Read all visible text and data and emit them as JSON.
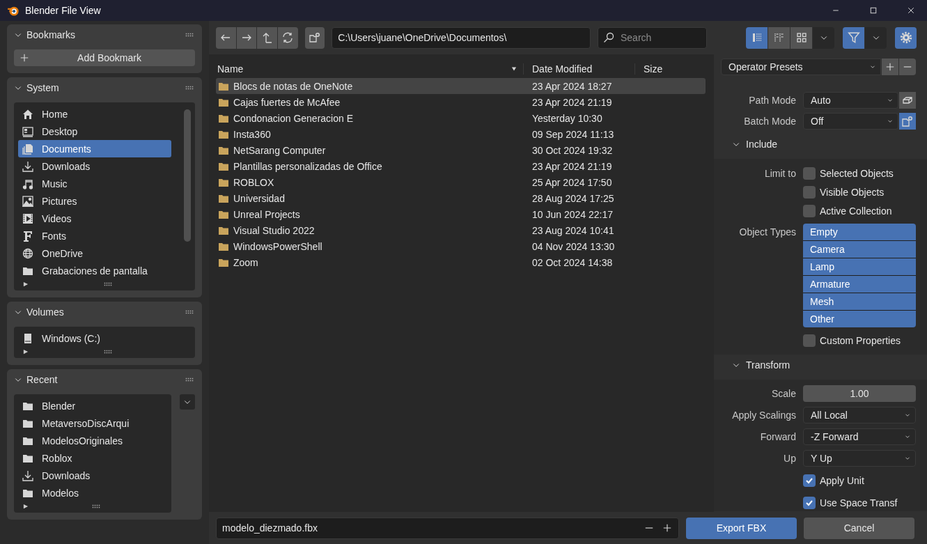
{
  "window": {
    "title": "Blender File View"
  },
  "sidebar": {
    "bookmarks": {
      "title": "Bookmarks",
      "expanded": true,
      "add_button": "Add Bookmark"
    },
    "system": {
      "title": "System",
      "expanded": true,
      "items": [
        {
          "label": "Home",
          "kind": "home",
          "selected": false
        },
        {
          "label": "Desktop",
          "kind": "desktop",
          "selected": false
        },
        {
          "label": "Documents",
          "kind": "documents",
          "selected": true
        },
        {
          "label": "Downloads",
          "kind": "download",
          "selected": false
        },
        {
          "label": "Music",
          "kind": "music",
          "selected": false
        },
        {
          "label": "Pictures",
          "kind": "picture",
          "selected": false
        },
        {
          "label": "Videos",
          "kind": "film",
          "selected": false
        },
        {
          "label": "Fonts",
          "kind": "font",
          "selected": false
        },
        {
          "label": "OneDrive",
          "kind": "globe",
          "selected": false
        },
        {
          "label": "Grabaciones de pantalla",
          "kind": "folder",
          "selected": false
        }
      ]
    },
    "volumes": {
      "title": "Volumes",
      "expanded": true,
      "items": [
        {
          "label": "Windows (C:)",
          "kind": "drive",
          "selected": false
        }
      ]
    },
    "recent": {
      "title": "Recent",
      "expanded": true,
      "items": [
        {
          "label": "Blender",
          "kind": "folder",
          "selected": false
        },
        {
          "label": "MetaversoDiscArqui",
          "kind": "folder",
          "selected": false
        },
        {
          "label": "ModelosOriginales",
          "kind": "folder",
          "selected": false
        },
        {
          "label": "Roblox",
          "kind": "folder",
          "selected": false
        },
        {
          "label": "Downloads",
          "kind": "download",
          "selected": false
        },
        {
          "label": "Modelos",
          "kind": "folder",
          "selected": false
        }
      ]
    }
  },
  "toolbar": {
    "path": "C:\\Users\\juane\\OneDrive\\Documentos\\",
    "search": {
      "placeholder": "Search"
    },
    "display_modes": [
      {
        "kind": "vertical",
        "selected": true
      },
      {
        "kind": "horizontal",
        "selected": false
      },
      {
        "kind": "thumbnails",
        "selected": false
      }
    ],
    "filter_on": true,
    "settings_on": true
  },
  "file_list": {
    "columns": [
      "Name",
      "Date Modified",
      "Size"
    ],
    "rows": [
      {
        "name": "Blocs de notas de OneNote",
        "date": "23 Apr 2024 18:27",
        "selected": true
      },
      {
        "name": "Cajas fuertes de McAfee",
        "date": "23 Apr 2024 21:19",
        "selected": false
      },
      {
        "name": "Condonacion Generacion E",
        "date": "Yesterday 10:30",
        "selected": false
      },
      {
        "name": "Insta360",
        "date": "09 Sep 2024 11:13",
        "selected": false
      },
      {
        "name": "NetSarang Computer",
        "date": "30 Oct 2024 19:32",
        "selected": false
      },
      {
        "name": "Plantillas personalizadas de Office",
        "date": "23 Apr 2024 21:19",
        "selected": false
      },
      {
        "name": "ROBLOX",
        "date": "25 Apr 2024 17:50",
        "selected": false
      },
      {
        "name": "Universidad",
        "date": "28 Aug 2024 17:25",
        "selected": false
      },
      {
        "name": "Unreal Projects",
        "date": "10 Jun 2024 22:17",
        "selected": false
      },
      {
        "name": "Visual Studio 2022",
        "date": "23 Aug 2024 10:41",
        "selected": false
      },
      {
        "name": "WindowsPowerShell",
        "date": "04 Nov 2024 13:30",
        "selected": false
      },
      {
        "name": "Zoom",
        "date": "02 Oct 2024 14:38",
        "selected": false
      }
    ]
  },
  "settings": {
    "presets": "Operator Presets",
    "path_mode": {
      "label": "Path Mode",
      "value": "Auto"
    },
    "batch_mode": {
      "label": "Batch Mode",
      "value": "Off"
    },
    "include": {
      "title": "Include",
      "expanded": true,
      "limit_label": "Limit to",
      "limits": [
        {
          "label": "Selected Objects",
          "checked": false
        },
        {
          "label": "Visible Objects",
          "checked": false
        },
        {
          "label": "Active Collection",
          "checked": false
        }
      ],
      "types_label": "Object Types",
      "types": [
        {
          "label": "Empty",
          "selected": true
        },
        {
          "label": "Camera",
          "selected": true
        },
        {
          "label": "Lamp",
          "selected": true
        },
        {
          "label": "Armature",
          "selected": true
        },
        {
          "label": "Mesh",
          "selected": true
        },
        {
          "label": "Other",
          "selected": true
        }
      ],
      "custom_properties": {
        "label": "Custom Properties",
        "checked": false
      }
    },
    "transform": {
      "title": "Transform",
      "expanded": true,
      "scale": {
        "label": "Scale",
        "value": "1.00"
      },
      "selects": [
        {
          "label": "Apply Scalings",
          "value": "All Local"
        },
        {
          "label": "Forward",
          "value": "-Z Forward"
        },
        {
          "label": "Up",
          "value": "Y Up"
        }
      ],
      "checks": [
        {
          "label": "Apply Unit",
          "checked": true
        },
        {
          "label": "Use Space Transf",
          "checked": true
        }
      ]
    }
  },
  "footer": {
    "filename": "modelo_diezmado.fbx",
    "export_button": "Export FBX",
    "cancel_button": "Cancel"
  }
}
